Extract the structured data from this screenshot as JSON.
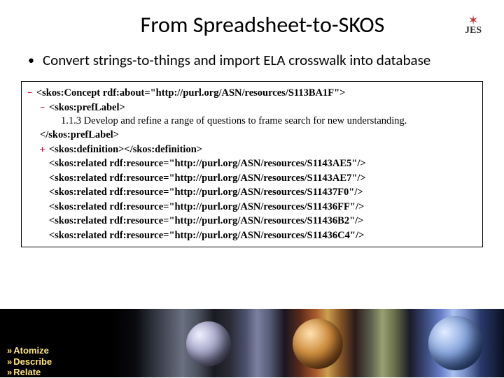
{
  "title": "From Spreadsheet-to-SKOS",
  "logo": {
    "text": "JES"
  },
  "bullet": "Convert strings-to-things and import ELA crosswalk into database",
  "code": {
    "concept_open_pre": "<skos:Concept rdf:about=",
    "concept_about": "\"http://purl.org/ASN/resources/S113BA1F\"",
    "concept_open_post": ">",
    "preflabel_open": "<skos:prefLabel>",
    "preflabel_text": "1.1.3 Develop and refine a range of questions to frame search for new understanding.",
    "preflabel_close": "</skos:prefLabel>",
    "definition": "<skos:definition></skos:definition>",
    "related_tag_open": "<skos:related rdf:resource=",
    "related_tag_close": "/>",
    "related": [
      "\"http://purl.org/ASN/resources/S1143AE5\"",
      "\"http://purl.org/ASN/resources/S1143AE7\"",
      "\"http://purl.org/ASN/resources/S11437F0\"",
      "\"http://purl.org/ASN/resources/S11436FF\"",
      "\"http://purl.org/ASN/resources/S11436B2\"",
      "\"http://purl.org/ASN/resources/S11436C4\""
    ]
  },
  "footer": {
    "items": [
      "Atomize",
      "Describe",
      "Relate"
    ]
  }
}
